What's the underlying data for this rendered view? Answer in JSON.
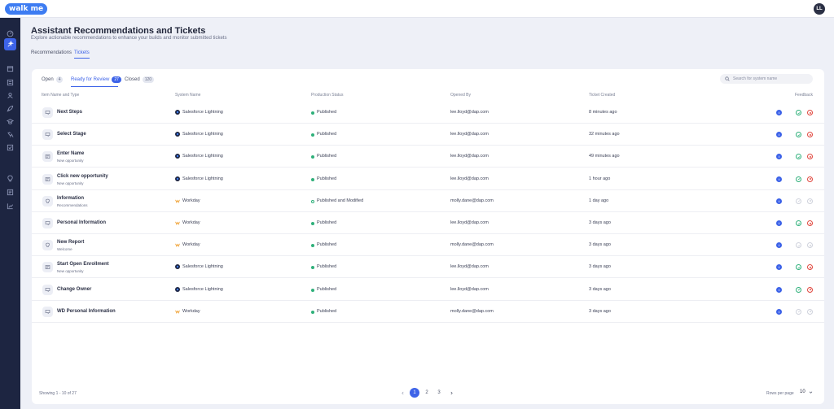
{
  "app": {
    "logo_text": "walk me",
    "avatar_initials": "LL"
  },
  "sidebar": {
    "icons": [
      "dashboard-icon",
      "assistant-icon",
      "calendar-icon",
      "list-icon",
      "people-icon",
      "rocket-icon",
      "cap-icon",
      "translate-icon",
      "checklist-icon",
      "bulb-icon",
      "report-icon",
      "chart-icon"
    ],
    "active": "assistant-icon"
  },
  "header": {
    "title": "Assistant Recommendations and Tickets",
    "subtitle": "Explore actionable recommendations to enhance your builds and monitor submitted tickets"
  },
  "top_tabs": [
    {
      "label": "Recommendations",
      "active": false
    },
    {
      "label": "Tickets",
      "active": true
    }
  ],
  "sub_tabs": [
    {
      "label": "Open",
      "count": "4",
      "active": false
    },
    {
      "label": "Ready for Review",
      "count": "27",
      "active": true
    },
    {
      "label": "Closed",
      "count": "120",
      "active": false
    }
  ],
  "search": {
    "placeholder": "Search for system name"
  },
  "columns": [
    "Item Name and Type",
    "System Name",
    "Production Status",
    "Opened By",
    "Ticket Created",
    "Feedback"
  ],
  "rows": [
    {
      "name": "Next Steps",
      "type": "",
      "icon": "launcher-icon",
      "system": "Salesforce Lightning",
      "system_icon": "salesforce",
      "status": "Published",
      "status_hollow": false,
      "opened_by": "lee.lloyd@dap.com",
      "created": "8 minutes ago",
      "feedback_active": true
    },
    {
      "name": "Select Stage",
      "type": "",
      "icon": "launcher-icon",
      "system": "Salesforce Lightning",
      "system_icon": "salesforce",
      "status": "Published",
      "status_hollow": false,
      "opened_by": "lee.lloyd@dap.com",
      "created": "32 minutes ago",
      "feedback_active": true
    },
    {
      "name": "Enter Name",
      "type": "New opportunity",
      "icon": "walkthru-icon",
      "system": "Salesforce Lightning",
      "system_icon": "salesforce",
      "status": "Published",
      "status_hollow": false,
      "opened_by": "lee.lloyd@dap.com",
      "created": "49 minutes ago",
      "feedback_active": true
    },
    {
      "name": "Click new opportunity",
      "type": "New opportunity",
      "icon": "walkthru-icon",
      "system": "Salesforce Lightning",
      "system_icon": "salesforce",
      "status": "Published",
      "status_hollow": false,
      "opened_by": "lee.lloyd@dap.com",
      "created": "1 hour ago",
      "feedback_active": true
    },
    {
      "name": "Information",
      "type": "Recommendations",
      "icon": "smarttip-icon",
      "system": "Workday",
      "system_icon": "workday",
      "status": "Published and Modified",
      "status_hollow": true,
      "opened_by": "molly.dane@dap.com",
      "created": "1 day ago",
      "feedback_active": false
    },
    {
      "name": "Personal Information",
      "type": "",
      "icon": "launcher-icon",
      "system": "Workday",
      "system_icon": "workday",
      "status": "Published",
      "status_hollow": false,
      "opened_by": "lee.lloyd@dap.com",
      "created": "3 days ago",
      "feedback_active": true
    },
    {
      "name": "New Report",
      "type": "Welcome",
      "icon": "smarttip-icon",
      "system": "Workday",
      "system_icon": "workday",
      "status": "Published",
      "status_hollow": false,
      "opened_by": "molly.dane@dap.com",
      "created": "3 days ago",
      "feedback_active": false
    },
    {
      "name": "Start Open Enrollment",
      "type": "New opportunity",
      "icon": "walkthru-icon",
      "system": "Salesforce Lightning",
      "system_icon": "salesforce",
      "status": "Published",
      "status_hollow": false,
      "opened_by": "lee.lloyd@dap.com",
      "created": "3 days ago",
      "feedback_active": true
    },
    {
      "name": "Change Owner",
      "type": "",
      "icon": "launcher-icon",
      "system": "Salesforce Lightning",
      "system_icon": "salesforce",
      "status": "Published",
      "status_hollow": false,
      "opened_by": "lee.lloyd@dap.com",
      "created": "3 days ago",
      "feedback_active": true
    },
    {
      "name": "WD Personal Information",
      "type": "",
      "icon": "launcher-icon",
      "system": "Workday",
      "system_icon": "workday",
      "status": "Published",
      "status_hollow": false,
      "opened_by": "molly.dane@dap.com",
      "created": "3 days ago",
      "feedback_active": false
    }
  ],
  "footer": {
    "showing": "Showing 1 - 10 of 27",
    "pages": [
      "1",
      "2",
      "3"
    ],
    "current_page": "1",
    "rows_per_page_label": "Rows per page",
    "rows_per_page_value": "10"
  },
  "colors": {
    "accent": "#3d63e8",
    "sidebar": "#1d2541",
    "published": "#2fb07a",
    "reject": "#e0483f"
  }
}
